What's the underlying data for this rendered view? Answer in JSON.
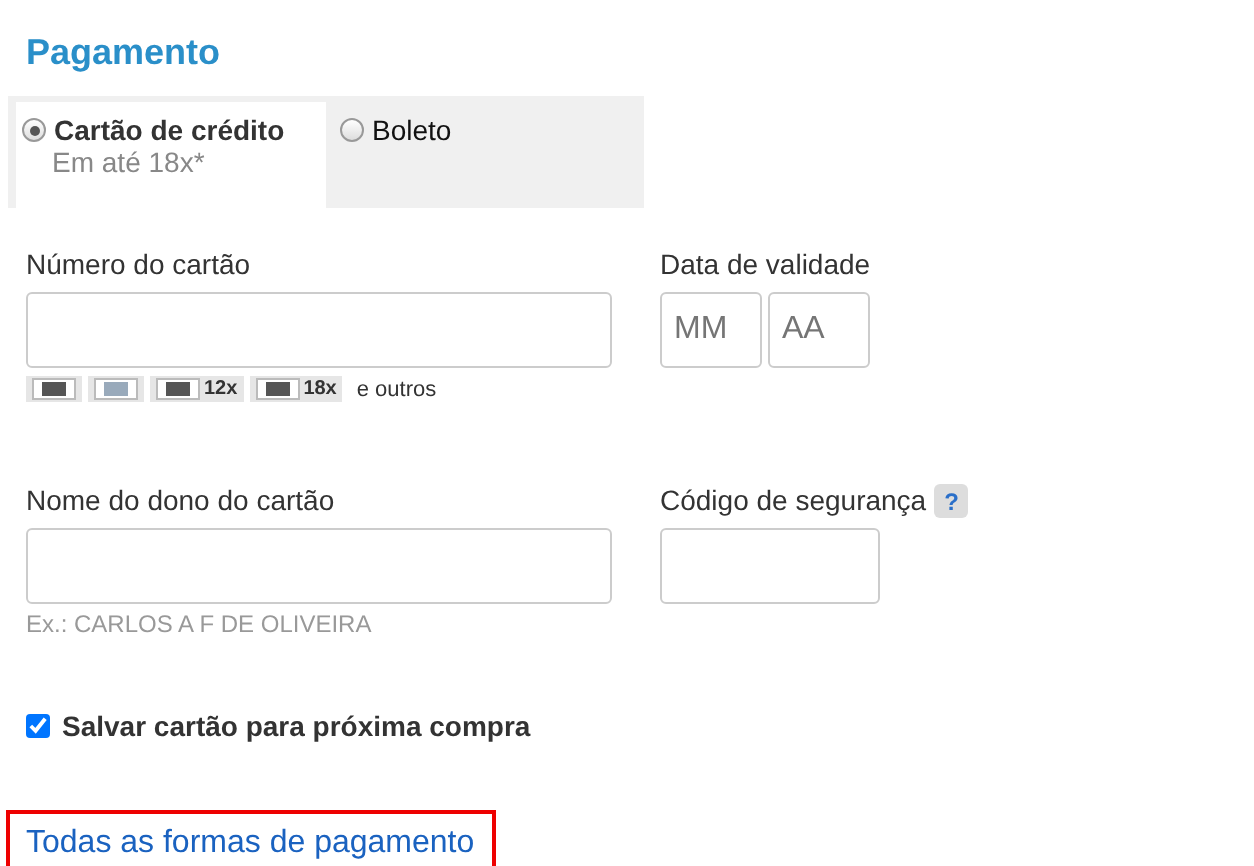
{
  "title": "Pagamento",
  "tabs": [
    {
      "label": "Cartão de crédito",
      "sublabel": "Em até 18x*",
      "selected": true
    },
    {
      "label": "Boleto",
      "selected": false
    }
  ],
  "card_number": {
    "label": "Número do cartão"
  },
  "card_brands": [
    {
      "kind": "card"
    },
    {
      "kind": "card"
    },
    {
      "kind": "card",
      "installments": "12x"
    },
    {
      "kind": "card",
      "installments": "18x"
    }
  ],
  "card_brands_more": "e outros",
  "expiry": {
    "label": "Data de validade",
    "month_placeholder": "MM",
    "year_placeholder": "AA"
  },
  "holder_name": {
    "label": "Nome do dono do cartão",
    "hint": "Ex.: CARLOS A F DE OLIVEIRA"
  },
  "security_code": {
    "label": "Código de segurança",
    "help": "?"
  },
  "save_card": {
    "label": "Salvar cartão para próxima compra",
    "checked": true
  },
  "all_methods_link": "Todas as formas de pagamento"
}
